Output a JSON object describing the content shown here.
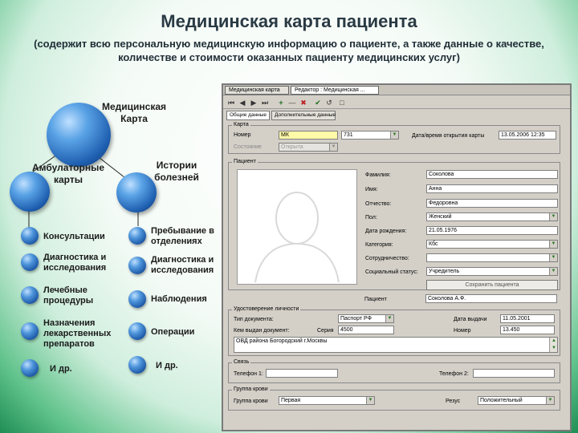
{
  "slide": {
    "title": "Медицинская карта пациента",
    "subtitle": "(содержит всю персональную медицинскую информацию о пациенте, а также данные о качестве, количестве и стоимости оказанных пациенту медицинских услуг)"
  },
  "diagram": {
    "root": "Медицинская\nКарта",
    "left_branch": "Амбулаторные\nкарты",
    "right_branch": "Истории\nболезней",
    "left_items": [
      "Консультации",
      "Диагностика и исследования",
      "Лечебные процедуры",
      "Назначения лекарственных препаратов",
      "И др."
    ],
    "right_items": [
      "Пребывание в отделениях",
      "Диагностика и исследования",
      "Наблюдения",
      "Операции",
      "И др."
    ]
  },
  "app": {
    "tabs": [
      "Медицинская карта",
      "Редактор : Медицинская ..."
    ],
    "toolbar_icons": [
      "first-icon",
      "prev-icon",
      "next-icon",
      "last-icon",
      "add-icon",
      "delete-icon",
      "edit-icon",
      "confirm-icon",
      "cancel-icon",
      "refresh-icon"
    ],
    "inner_tabs": [
      "Общие данные",
      "Дополнительные данные"
    ],
    "card": {
      "group_title": "Карта",
      "number_label": "Номер",
      "number_prefix": "МК",
      "number_value": "731",
      "status_label": "Состояние",
      "status_value": "Открыта",
      "datetime_label": "Дата/время открытия карты",
      "datetime_value": "13.05.2006 12:35"
    },
    "patient": {
      "group_title": "Пациент",
      "fields": [
        {
          "label": "Фамилия:",
          "value": "Соколова",
          "dropdown": false
        },
        {
          "label": "Имя:",
          "value": "Анна",
          "dropdown": false
        },
        {
          "label": "Отчество:",
          "value": "Федоровна",
          "dropdown": false
        },
        {
          "label": "Пол:",
          "value": "Женский",
          "dropdown": true
        },
        {
          "label": "Дата рождения:",
          "value": "21.05.1976",
          "dropdown": false
        },
        {
          "label": "Категория:",
          "value": "Кбс",
          "dropdown": true
        },
        {
          "label": "Сотрудничество:",
          "value": "",
          "dropdown": true
        },
        {
          "label": "Социальный статус:",
          "value": "Учредитель",
          "dropdown": true
        }
      ],
      "button_label": "Сохранить пациента",
      "patient_label": "Пациент",
      "patient_value": "Соколова А.Ф."
    },
    "identity": {
      "group_title": "Удостоверение личности",
      "doc_type_label": "Тип документа:",
      "doc_type_value": "Паспорт РФ",
      "issue_date_label": "Дата выдачи",
      "issue_date_value": "11.05.2001",
      "issued_by_label": "Кем выдан документ:",
      "series_label": "Серия",
      "series_value": "4500",
      "number_label": "Номер",
      "number_value": "13.450",
      "issued_by_value": "ОВД района Богородский г.Москвы"
    },
    "phones": {
      "group_title": "Связь",
      "phone1_label": "Телефон 1:",
      "phone2_label": "Телефон 2:"
    },
    "blood": {
      "group_title": "Группа крови",
      "blood_label": "Группа крови",
      "blood_value": "Первая",
      "rh_label": "Резус",
      "rh_value": "Положительный"
    }
  }
}
